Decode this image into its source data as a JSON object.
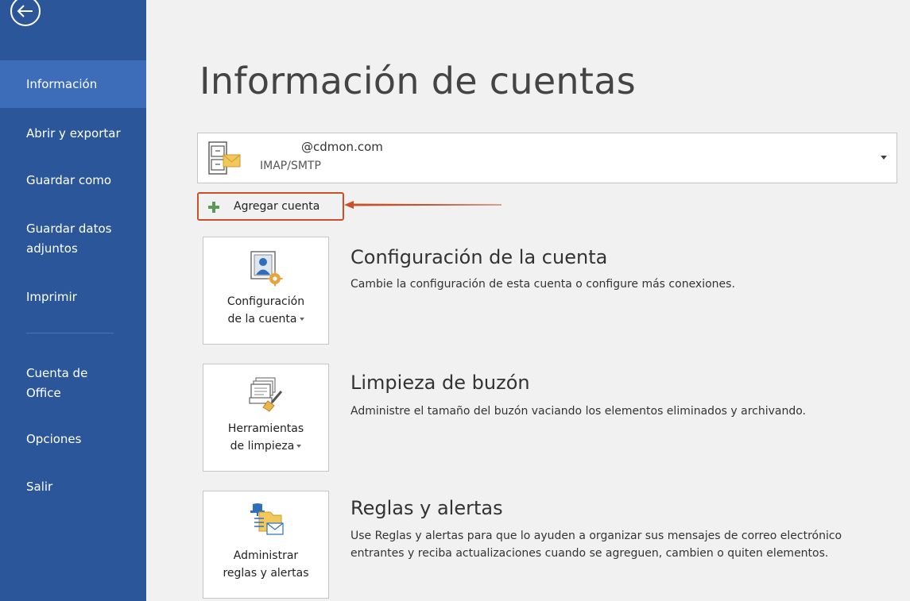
{
  "sidebar": {
    "back_label": "",
    "items": [
      {
        "label": "Información",
        "active": true
      },
      {
        "label": "Abrir y exportar"
      },
      {
        "label": "Guardar como"
      },
      {
        "label": "Guardar datos adjuntos",
        "lines": [
          "Guardar datos",
          "adjuntos"
        ]
      },
      {
        "label": "Imprimir"
      },
      {
        "label": "Cuenta de Office",
        "lines": [
          "Cuenta de",
          "Office"
        ]
      },
      {
        "label": "Opciones"
      },
      {
        "label": "Salir"
      }
    ]
  },
  "main": {
    "title": "Información de cuentas",
    "account": {
      "email": "@cdmon.com",
      "type": "IMAP/SMTP"
    },
    "add_account_label": "Agregar cuenta",
    "sections": [
      {
        "button_lines": [
          "Configuración",
          "de la cuenta"
        ],
        "title": "Configuración de la cuenta",
        "description": "Cambie la configuración de esta cuenta o configure más conexiones."
      },
      {
        "button_lines": [
          "Herramientas",
          "de limpieza"
        ],
        "title": "Limpieza de buzón",
        "description": "Administre el tamaño del buzón vaciando los elementos eliminados y archivando."
      },
      {
        "button_lines": [
          "Administrar",
          "reglas y alertas"
        ],
        "title": "Reglas y alertas",
        "description": "Use Reglas y alertas para que lo ayuden a organizar sus mensajes de correo electrónico entrantes y reciba actualizaciones cuando se agreguen, cambien o quiten elementos."
      }
    ]
  },
  "colors": {
    "sidebar_bg": "#2b579a",
    "sidebar_active": "#3d6cb8",
    "highlight": "#c8502b",
    "plus_green": "#5b9b57"
  },
  "icons": {
    "back": "back-arrow-icon",
    "account": "mail-cabinet-icon",
    "add": "plus-icon",
    "settings": "account-settings-icon",
    "cleanup": "cleanup-tools-icon",
    "rules": "rules-alerts-icon"
  }
}
